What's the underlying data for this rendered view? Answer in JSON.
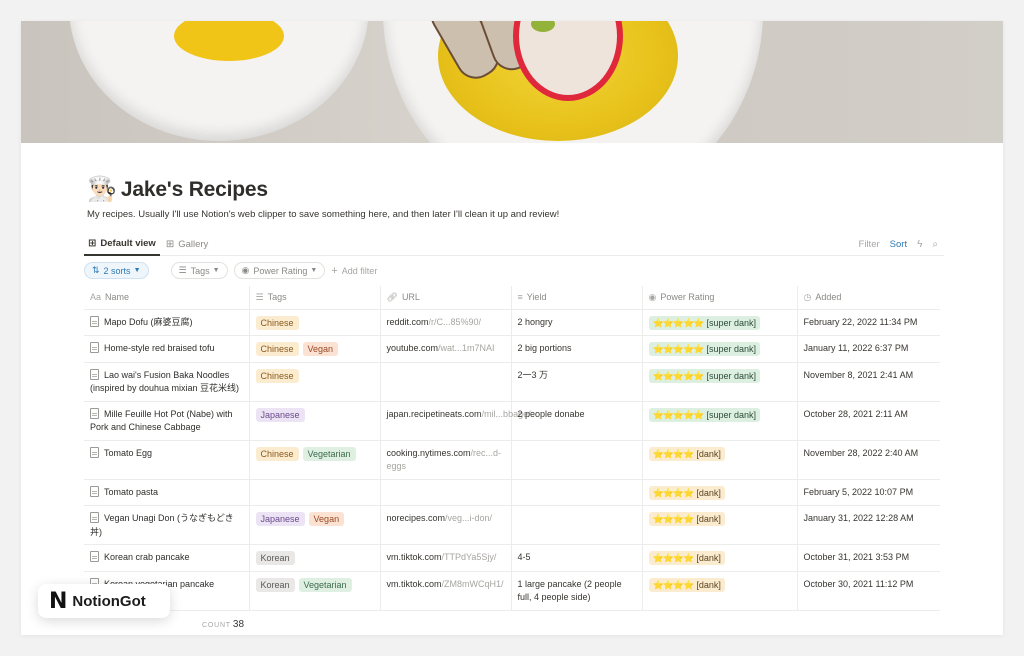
{
  "page": {
    "icon": "👨🏻‍🍳",
    "title": "Jake's Recipes",
    "description": "My recipes. Usually I'll use Notion's web clipper to save something here, and then later I'll clean it up and review!"
  },
  "tabs": [
    {
      "label": "Default view",
      "icon": "table-icon",
      "active": true
    },
    {
      "label": "Gallery",
      "icon": "gallery-icon",
      "active": false
    }
  ],
  "toolbar": {
    "filter_label": "Filter",
    "sort_label": "Sort",
    "automation_icon": "lightning-icon",
    "search_icon": "search-icon"
  },
  "filters": {
    "sorts_label": "2 sorts",
    "tags_label": "Tags",
    "power_rating_label": "Power Rating",
    "add_filter_label": "Add filter"
  },
  "columns": [
    {
      "label": "Name",
      "icon": "Aa"
    },
    {
      "label": "Tags",
      "icon": "☰"
    },
    {
      "label": "URL",
      "icon": "🔗"
    },
    {
      "label": "Yield",
      "icon": "≡"
    },
    {
      "label": "Power Rating",
      "icon": "◉"
    },
    {
      "label": "Added",
      "icon": "◷"
    }
  ],
  "rows": [
    {
      "name": "Mapo Dofu (麻婆豆腐)",
      "tags": [
        "Chinese"
      ],
      "url_host": "reddit.com",
      "url_path": "/r/C...85%90/",
      "yield": "2 hongry",
      "rating_stars": "⭐⭐⭐⭐⭐",
      "rating_label": "[super dank]",
      "rating_level": "super",
      "added": "February 22, 2022 11:34 PM"
    },
    {
      "name": "Home-style red braised tofu",
      "tags": [
        "Chinese",
        "Vegan"
      ],
      "url_host": "youtube.com",
      "url_path": "/wat...1m7NAI",
      "yield": "2 big portions",
      "rating_stars": "⭐⭐⭐⭐⭐",
      "rating_label": "[super dank]",
      "rating_level": "super",
      "added": "January 11, 2022 6:37 PM"
    },
    {
      "name": "Lao wai's Fusion Baka Noodles (inspired by douhua mixian 豆花米线)",
      "tags": [
        "Chinese"
      ],
      "url_host": "",
      "url_path": "",
      "yield": "2一3 万",
      "rating_stars": "⭐⭐⭐⭐⭐",
      "rating_label": "[super dank]",
      "rating_level": "super",
      "added": "November 8, 2021 2:41 AM"
    },
    {
      "name": "Mille Feuille Hot Pot (Nabe) with Pork and Chinese Cabbage",
      "tags": [
        "Japanese"
      ],
      "url_host": "japan.recipetineats.com",
      "url_path": "/mil...bbage/",
      "yield": "2 people donabe",
      "rating_stars": "⭐⭐⭐⭐⭐",
      "rating_label": "[super dank]",
      "rating_level": "super",
      "added": "October 28, 2021 2:11 AM"
    },
    {
      "name": "Tomato Egg",
      "tags": [
        "Chinese",
        "Vegetarian"
      ],
      "url_host": "cooking.nytimes.com",
      "url_path": "/rec...d-eggs",
      "yield": "",
      "rating_stars": "⭐⭐⭐⭐",
      "rating_label": "[dank]",
      "rating_level": "dank",
      "added": "November 28, 2022 2:40 AM"
    },
    {
      "name": "Tomato pasta",
      "tags": [],
      "url_host": "",
      "url_path": "",
      "yield": "",
      "rating_stars": "⭐⭐⭐⭐",
      "rating_label": "[dank]",
      "rating_level": "dank",
      "added": "February 5, 2022 10:07 PM"
    },
    {
      "name": "Vegan Unagi Don (うなぎもどき丼)",
      "tags": [
        "Japanese",
        "Vegan"
      ],
      "url_host": "norecipes.com",
      "url_path": "/veg...i-don/",
      "yield": "",
      "rating_stars": "⭐⭐⭐⭐",
      "rating_label": "[dank]",
      "rating_level": "dank",
      "added": "January 31, 2022 12:28 AM"
    },
    {
      "name": "Korean crab pancake",
      "tags": [
        "Korean"
      ],
      "url_host": "vm.tiktok.com",
      "url_path": "/TTPdYa5Sjy/",
      "yield": "4-5",
      "rating_stars": "⭐⭐⭐⭐",
      "rating_label": "[dank]",
      "rating_level": "dank",
      "added": "October 31, 2021 3:53 PM"
    },
    {
      "name": "Korean vegetarian pancake",
      "tags": [
        "Korean",
        "Vegetarian"
      ],
      "url_host": "vm.tiktok.com",
      "url_path": "/ZM8mWCqH1/",
      "yield": "1 large pancake (2 people full, 4 people side)",
      "rating_stars": "⭐⭐⭐⭐",
      "rating_label": "[dank]",
      "rating_level": "dank",
      "added": "October 30, 2021 11:12 PM"
    }
  ],
  "footer": {
    "count_label": "COUNT",
    "count_value": "38"
  },
  "badge": {
    "logo": "N",
    "text": "NotionGot"
  }
}
